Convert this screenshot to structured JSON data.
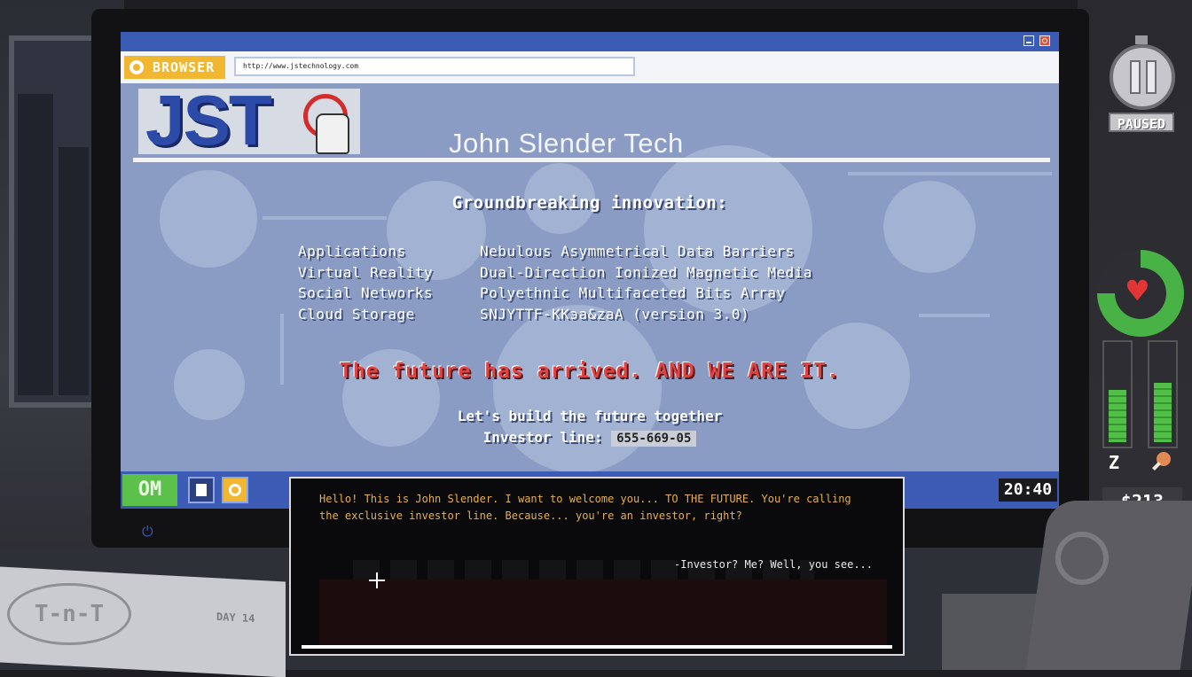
{
  "browser": {
    "app_label": "BROWSER",
    "url": "http://www.jstechnology.com"
  },
  "site": {
    "logo_text": "JST",
    "title": "John Slender Tech",
    "headline": "Groundbreaking innovation:",
    "products_left": [
      "Applications",
      "Virtual Reality",
      "Social Networks",
      "Cloud Storage"
    ],
    "products_right": [
      "Nebulous Asymmetrical Data Barriers",
      "Dual-Direction Ionized Magnetic Media",
      "Polyethnic Multifaceted Bits Array",
      "SNJYTTF-KKэa&zaA (version 3.0)"
    ],
    "tagline": "The future has arrived. AND WE ARE IT.",
    "cta_line": "Let's build the future together",
    "investor_label": "Investor line:",
    "investor_phone": "655-669-05"
  },
  "taskbar": {
    "start_label": "OM",
    "clock": "20:40"
  },
  "hud": {
    "paused_label": "PAUSED",
    "health_fraction": 0.75,
    "sleep_level": 0.55,
    "food_level": 0.62,
    "sleep_icon": "Z",
    "money": "$213"
  },
  "desk": {
    "logo_text": "T-n-T",
    "day_label": "DAY 14"
  },
  "dialog": {
    "text": "Hello! This is John Slender. I want to welcome you... TO THE FUTURE. You're calling the exclusive investor line. Because... you're an investor, right?",
    "reply_option": "-Investor? Me? Well, you see..."
  }
}
